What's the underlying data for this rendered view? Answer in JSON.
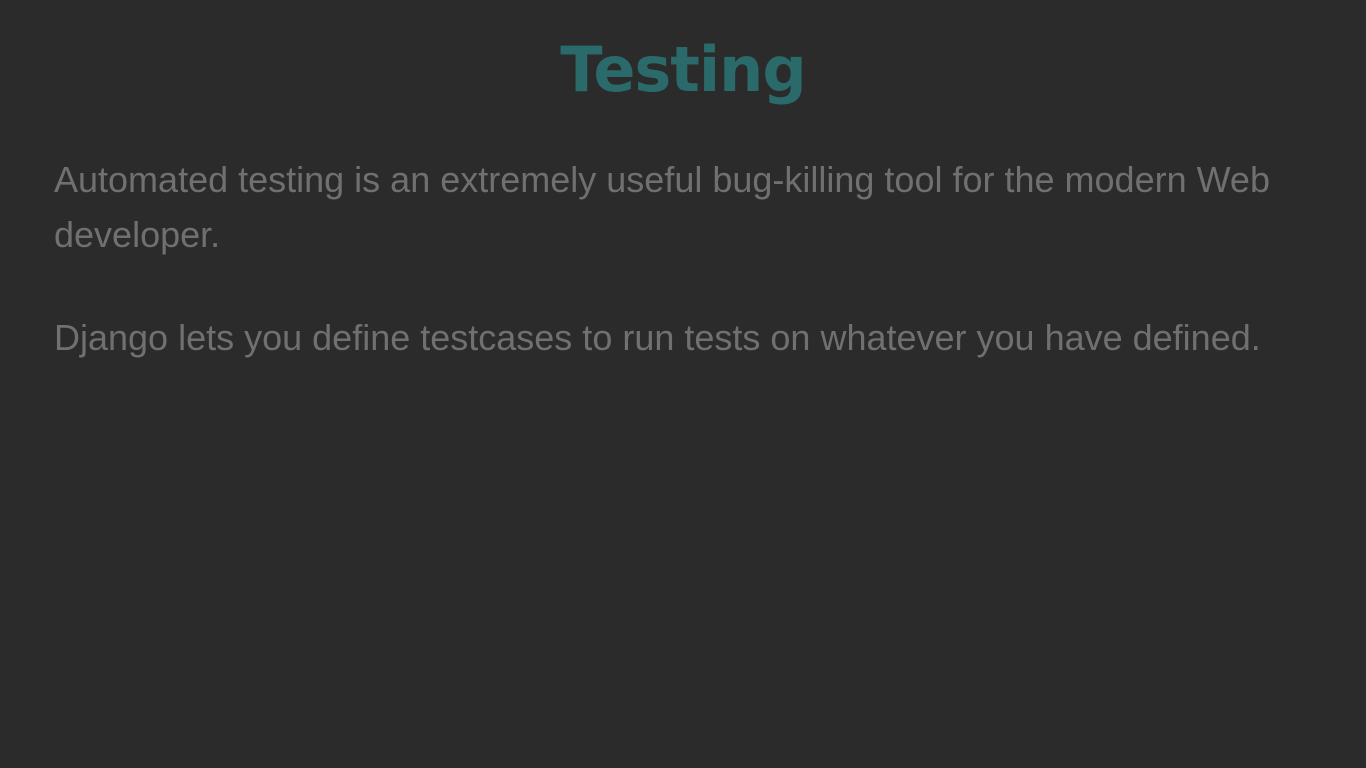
{
  "slide": {
    "title": "Testing",
    "paragraphs": [
      "Automated testing is an extremely useful bug-killing tool for the modern Web developer.",
      "Django lets you define testcases to run tests on whatever you have defined."
    ]
  },
  "colors": {
    "background": "#2b2b2b",
    "title": "#2a6a6a",
    "body_text": "#707070"
  }
}
